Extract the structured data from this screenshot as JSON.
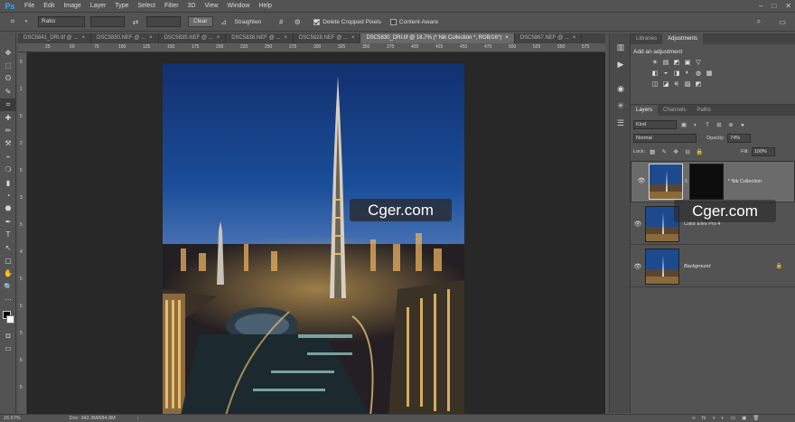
{
  "app": {
    "logo": "Ps"
  },
  "menu": [
    "File",
    "Edit",
    "Image",
    "Layer",
    "Type",
    "Select",
    "Filter",
    "3D",
    "View",
    "Window",
    "Help"
  ],
  "window_controls": [
    "–",
    "□",
    "✕"
  ],
  "options": {
    "ratio_label": "Ratio",
    "swap_icon": "⇄",
    "clear_label": "Clear",
    "straighten_label": "Straighten",
    "delete_cropped_label": "Delete Cropped Pixels",
    "content_aware_label": "Content-Aware",
    "search_icon": "⌕",
    "workspace_icon": "▭"
  },
  "tabs": [
    {
      "label": "DSC5841_DRI.tif @ ...",
      "close": "×"
    },
    {
      "label": "DSC5830.NEF @ ...",
      "close": "×"
    },
    {
      "label": "DSC5835.NEF @ ...",
      "close": "×"
    },
    {
      "label": "DSC5838.NEF @ ...",
      "close": "×"
    },
    {
      "label": "DSC5828.NEF @ ...",
      "close": "×"
    },
    {
      "label": "DSC5830_DRI.tif @ 16.7% (* Nik Collection *, RGB/16*)",
      "close": "×"
    },
    {
      "label": "DSC5867.NEF @ ...",
      "close": "×"
    }
  ],
  "ruler_h_ticks": [
    "25",
    "50",
    "75",
    "100",
    "125",
    "150",
    "175",
    "200",
    "225",
    "250",
    "275",
    "300",
    "325",
    "350",
    "375",
    "400",
    "425",
    "450",
    "475",
    "500",
    "525",
    "550",
    "575"
  ],
  "ruler_v_ticks": [
    "5",
    "1",
    "5",
    "2",
    "5",
    "3",
    "5",
    "4",
    "5",
    "5",
    "5",
    "6",
    "5"
  ],
  "watermark": "Cger.com",
  "status": {
    "zoom": "16.67%",
    "doc": "Doc: 342.3M/684.8M",
    "arrow": "›"
  },
  "panels": {
    "top_tabs": [
      "Libraries",
      "Adjustments"
    ],
    "adjust_title": "Add an adjustment",
    "adjust_row1": [
      "☀",
      "▤",
      "◩",
      "▣",
      "▽"
    ],
    "adjust_row2": [
      "◧",
      "◒",
      "◨",
      "◐",
      "◍",
      "▦"
    ],
    "adjust_row3": [
      "◫",
      "◪",
      "⚟",
      "▨",
      "◩"
    ],
    "layer_tabs": [
      "Layers",
      "Channels",
      "Paths"
    ],
    "kind_label": "Kind",
    "filter_icons": [
      "▣",
      "◐",
      "T",
      "⊞",
      "⊕",
      "●"
    ],
    "blend_mode": "Normal",
    "opacity_label": "Opacity:",
    "opacity_value": "74%",
    "lock_label": "Lock:",
    "lock_icons": [
      "▦",
      "✎",
      "✥",
      "⊟",
      "🔒"
    ],
    "fill_label": "Fill:",
    "fill_value": "100%",
    "layers": [
      {
        "name": "* Nik Collection",
        "eye": "👁",
        "link": "8"
      },
      {
        "name": "Color Efex Pro 4",
        "eye": "👁"
      },
      {
        "name": "Background",
        "eye": "👁",
        "lock": "🔒"
      }
    ],
    "bottom_icons": [
      "∞",
      "fx",
      "◑",
      "◐",
      "▭",
      "▣",
      "🗑"
    ]
  },
  "tools": [
    "✥",
    "⬚",
    "ʘ",
    "✎",
    "⌗",
    "✚",
    "✏",
    "⚒",
    "⌁",
    "❍",
    "▮",
    "◔",
    "⬣",
    "✒",
    "T",
    "↖",
    "▢",
    "✋",
    "🔍",
    "⋯"
  ]
}
